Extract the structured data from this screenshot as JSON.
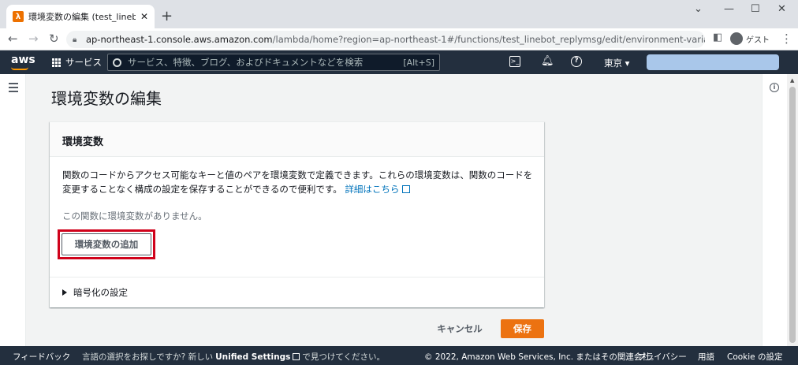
{
  "browser": {
    "tab_title": "環境変数の編集 (test_linebot_rep",
    "favicon_glyph": "λ",
    "url_host": "ap-northeast-1.console.aws.amazon.com",
    "url_path": "/lambda/home?region=ap-northeast-1#/functions/test_linebot_replymsg/edit/environment-variables?tab=code",
    "profile_label": "ゲスト"
  },
  "aws_header": {
    "logo": "aws",
    "services_label": "サービス",
    "search_placeholder": "サービス、特徴、ブログ、およびドキュメントなどを検索",
    "search_shortcut": "[Alt+S]",
    "region": "東京 ▾"
  },
  "page": {
    "title": "環境変数の編集"
  },
  "panel": {
    "heading": "環境変数",
    "description": "関数のコードからアクセス可能なキーと値のペアを環境変数で定義できます。これらの環境変数は、関数のコードを変更することなく構成の設定を保存することができるので便利です。",
    "learn_more": "詳細はこちら",
    "empty_message": "この関数に環境変数がありません。",
    "add_button": "環境変数の追加",
    "encryption_label": "暗号化の設定"
  },
  "actions": {
    "cancel": "キャンセル",
    "save": "保存"
  },
  "footer": {
    "feedback": "フィードバック",
    "language_prefix": "言語の選択をお探しですか? 新しい",
    "unified_settings": "Unified Settings",
    "language_suffix": "で見つけてください。",
    "copyright": "© 2022, Amazon Web Services, Inc. またはその関連会社。",
    "privacy": "プライバシー",
    "terms": "用語",
    "cookie": "Cookie の設定"
  },
  "colors": {
    "aws_nav": "#232f3e",
    "primary_button": "#ec7211",
    "link": "#0073bb",
    "highlight": "#d0021b"
  }
}
